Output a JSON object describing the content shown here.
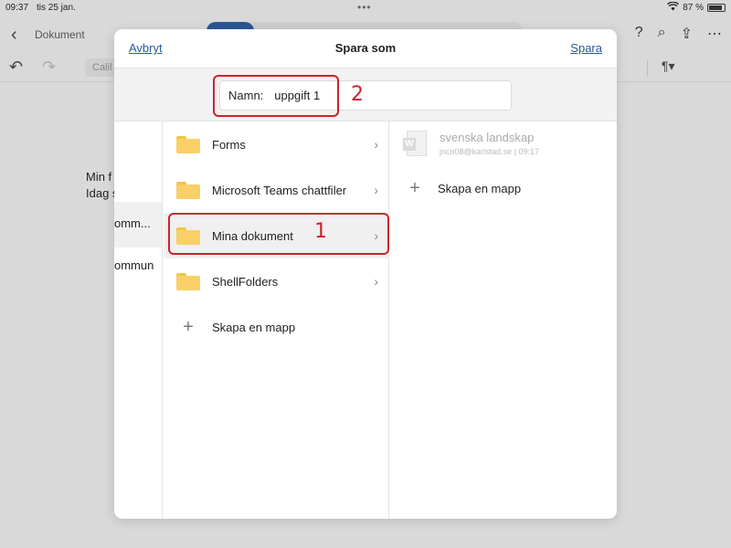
{
  "status_bar": {
    "time": "09:37",
    "date": "tis 25 jan.",
    "battery": "87 %",
    "battery_level": 0.87
  },
  "app": {
    "back_label": "Dokument",
    "font_box": "Calil",
    "doc_lines": [
      "Min f",
      "Idag s"
    ],
    "side_items": [
      "omm...",
      "ommun"
    ]
  },
  "dialog": {
    "title": "Spara som",
    "cancel_label": "Avbryt",
    "save_label": "Spara",
    "name_label": "Namn:",
    "name_value": "uppgift 1",
    "folders": [
      {
        "label": "Forms"
      },
      {
        "label": "Microsoft Teams chattfiler"
      },
      {
        "label": "Mina dokument"
      },
      {
        "label": "ShellFolders"
      }
    ],
    "new_folder_label": "Skapa en mapp",
    "files": [
      {
        "name": "svenska landskap",
        "sub": "jncn08@karlstad.se | 09:17"
      }
    ],
    "right_new_folder_label": "Skapa en mapp"
  },
  "annotations": {
    "one": "1",
    "two": "2",
    "color": "#d21f2b"
  },
  "colors": {
    "link": "#2757a8",
    "folder": "#f8d067"
  }
}
